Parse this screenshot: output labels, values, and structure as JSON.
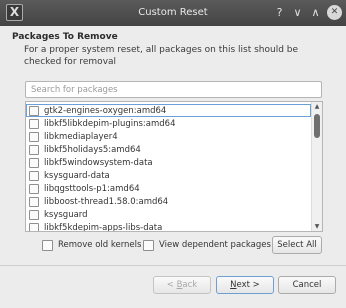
{
  "window": {
    "title": "Custom Reset",
    "app_icon": "X",
    "help_glyph": "?",
    "minimize_glyph": "∨",
    "maximize_glyph": "∧",
    "close_glyph": "✕"
  },
  "section": {
    "title": "Packages To Remove",
    "description": "For a proper system reset, all packages on this list should be checked for removal"
  },
  "search": {
    "placeholder": "Search for packages",
    "value": ""
  },
  "packages": [
    {
      "label": "gtk2-engines-oxygen:amd64",
      "checked": false,
      "selected": true
    },
    {
      "label": "libkf5libkdepim-plugins:amd64",
      "checked": false,
      "selected": false
    },
    {
      "label": "libkmediaplayer4",
      "checked": false,
      "selected": false
    },
    {
      "label": "libkf5holidays5:amd64",
      "checked": false,
      "selected": false
    },
    {
      "label": "libkf5windowsystem-data",
      "checked": false,
      "selected": false
    },
    {
      "label": "ksysguard-data",
      "checked": false,
      "selected": false
    },
    {
      "label": "libqgsttools-p1:amd64",
      "checked": false,
      "selected": false
    },
    {
      "label": "libboost-thread1.58.0:amd64",
      "checked": false,
      "selected": false
    },
    {
      "label": "ksysguard",
      "checked": false,
      "selected": false
    },
    {
      "label": "libkf5kdepim-apps-libs-data",
      "checked": false,
      "selected": false
    }
  ],
  "scrollbar": {
    "up_glyph": "▲",
    "down_glyph": "▼"
  },
  "options": {
    "remove_old_kernels": {
      "label": "Remove old kernels",
      "checked": false
    },
    "view_dependent": {
      "label": "View dependent packages",
      "checked": false
    }
  },
  "buttons": {
    "select_all": "Select All",
    "back_prefix": "< ",
    "back_mnemonic": "B",
    "back_rest": "ack",
    "next_mnemonic": "N",
    "next_rest": "ext >",
    "cancel": "Cancel"
  }
}
